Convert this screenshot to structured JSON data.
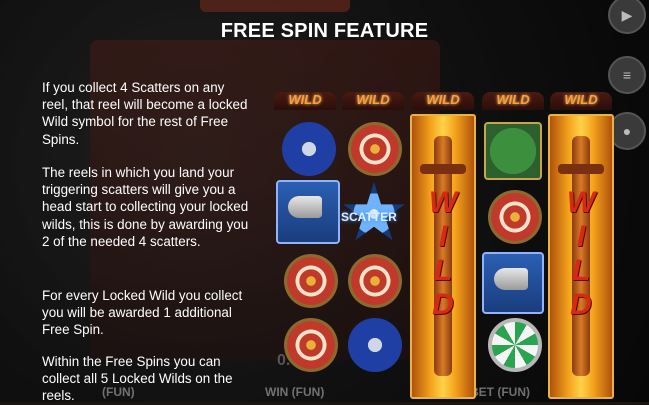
{
  "title": "FREE SPIN FEATURE",
  "paragraphs": [
    "If you collect 4 Scatters on any reel, that reel will become a locked Wild symbol for the rest of Free Spins.",
    "The reels in which you land your triggering scatters will give you a head start to collecting your locked wilds, this is done by awarding you 2 of the needed 4 scatters.",
    "For every Locked Wild you collect you will be awarded 1 additional Free Spin.",
    "Within the Free Spins you can collect all 5 Locked Wilds on the reels."
  ],
  "reel_tags": [
    "WILD",
    "WILD",
    "WILD",
    "WILD",
    "WILD"
  ],
  "locked_wild_text": "WILD",
  "scatter_label": "SCATTER",
  "bottom_bar": {
    "left_label": "(FUN)",
    "win_label": "WIN (FUN)",
    "win_value": "0.00",
    "bet_label": "BET (FUN)"
  },
  "symbols": {
    "reel1": [
      "shield-blue",
      "horn-tile",
      "shield-red",
      "shield-red"
    ],
    "reel2": [
      "shield-red",
      "scatter",
      "shield-red",
      "shield-blue"
    ],
    "reel4": [
      "axes-tile",
      "shield-red",
      "horn-tile",
      "shield-green"
    ]
  },
  "colors": {
    "wild_tag": "#ff9e3a",
    "wild_letters": "#d62a13",
    "text": "#ffffff"
  }
}
